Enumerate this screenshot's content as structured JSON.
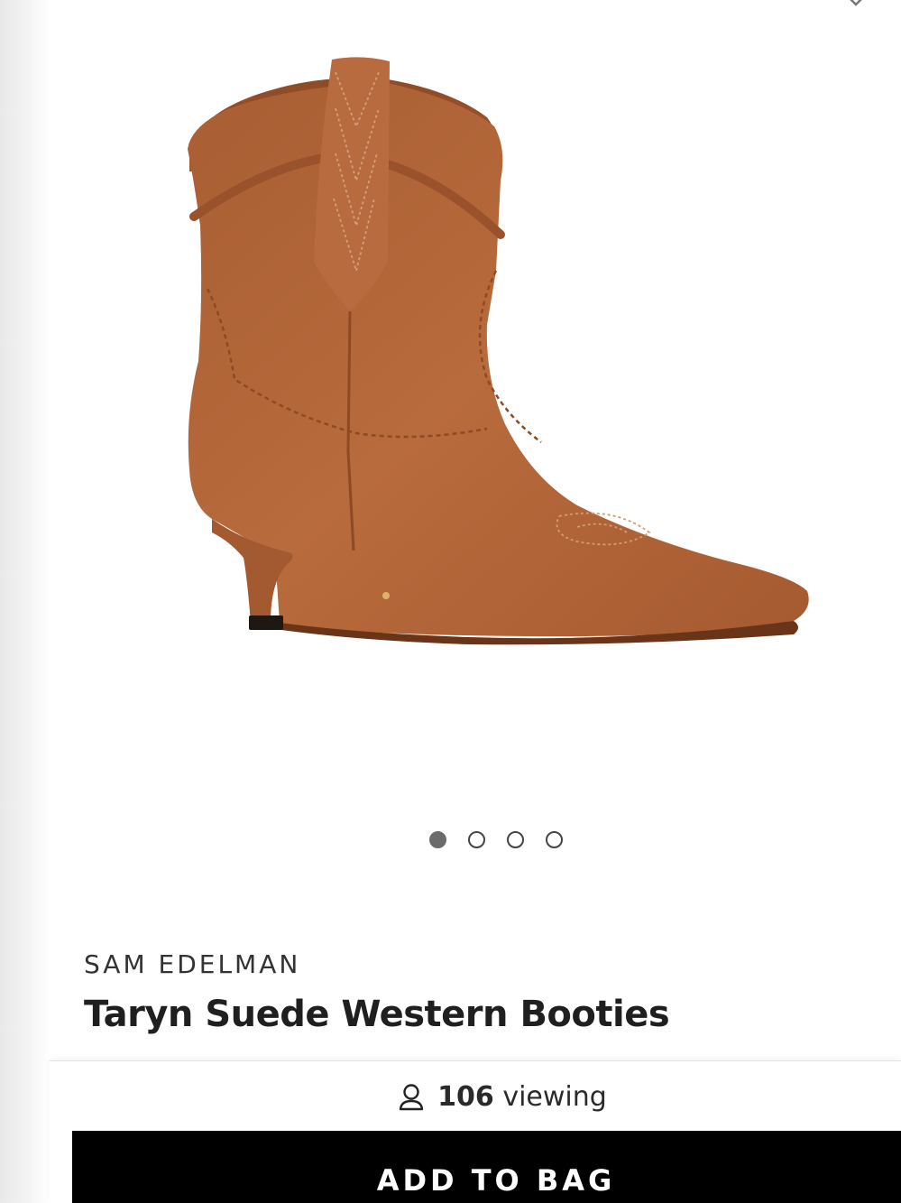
{
  "product": {
    "brand": "SAM EDELMAN",
    "title": "Taryn Suede Western Booties",
    "image_alt": "Taryn Suede Western Booties",
    "color": "#b5683a"
  },
  "carousel": {
    "total": 4,
    "active_index": 0
  },
  "icons": {
    "top_chevron": "chevron-down-icon",
    "viewers": "person-icon"
  },
  "viewing": {
    "count": "106",
    "label": "viewing"
  },
  "actions": {
    "add_to_bag": "ADD TO BAG"
  }
}
